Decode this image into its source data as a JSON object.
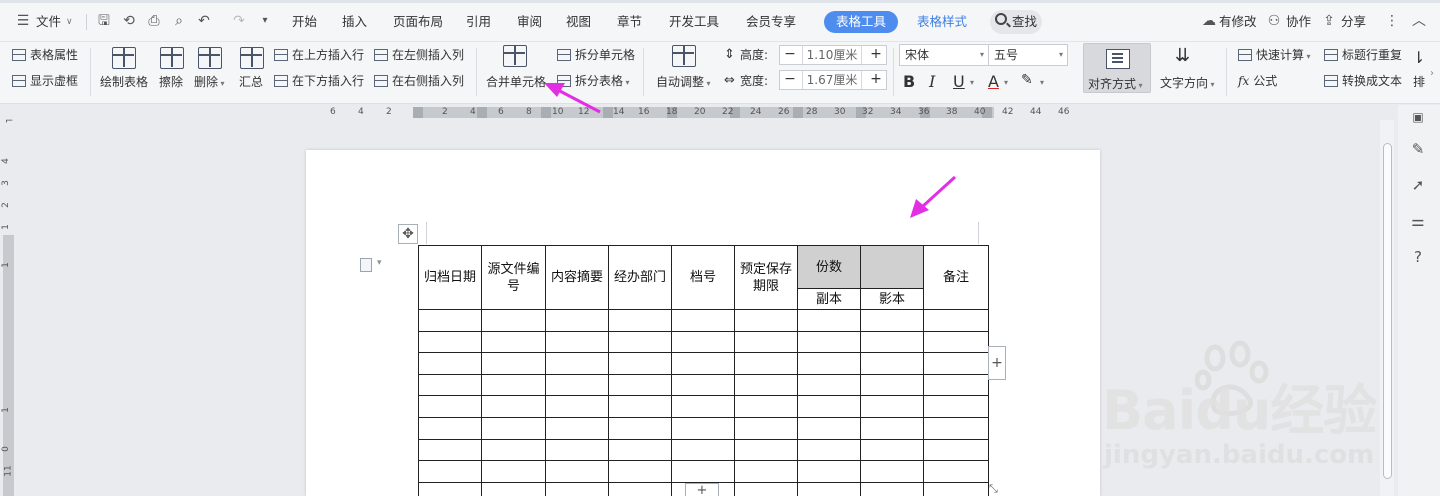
{
  "menubar": {
    "file": "文件",
    "tabs": [
      "开始",
      "插入",
      "页面布局",
      "引用",
      "审阅",
      "视图",
      "章节",
      "开发工具",
      "会员专享"
    ],
    "active_tab": "表格工具",
    "style_tab": "表格样式",
    "search": "查找",
    "right": {
      "changes": "有修改",
      "collab": "协作",
      "share": "分享"
    }
  },
  "ribbon": {
    "table_props": "表格属性",
    "show_grid": "显示虚框",
    "draw_table": "绘制表格",
    "erase": "擦除",
    "delete": "删除",
    "summary": "汇总",
    "insert_above": "在上方插入行",
    "insert_below": "在下方插入行",
    "insert_left": "在左侧插入列",
    "insert_right": "在右侧插入列",
    "merge_cells": "合并单元格",
    "split_cells": "拆分单元格",
    "split_table": "拆分表格",
    "auto_fit": "自动调整",
    "height_label": "高度:",
    "height_value": "1.10厘米",
    "width_label": "宽度:",
    "width_value": "1.67厘米",
    "font_name": "宋体",
    "font_size": "五号",
    "align": "对齐方式",
    "text_direction": "文字方向",
    "quick_calc": "快速计算",
    "formula": "公式",
    "repeat_header": "标题行重复",
    "convert_text": "转换成文本",
    "sort": "排"
  },
  "ruler": {
    "h_ticks": [
      "6",
      "4",
      "2",
      "2",
      "4",
      "6",
      "8",
      "10",
      "12",
      "14",
      "16",
      "18",
      "20",
      "22",
      "24",
      "26",
      "28",
      "30",
      "32",
      "34",
      "36",
      "38",
      "40",
      "42",
      "44",
      "46"
    ],
    "v_ticks": [
      "4",
      "3",
      "2",
      "1",
      "1",
      "1",
      "0",
      "11"
    ]
  },
  "table": {
    "header": [
      "归档日期",
      "源文件编号",
      "内容摘要",
      "经办部门",
      "档号",
      "预定保存期限",
      "份数",
      "",
      "备注"
    ],
    "subheader": [
      "副本",
      "影本"
    ],
    "body_rows": 9,
    "columns": 9,
    "highlight_color": "#d0d0d0"
  },
  "watermark": {
    "brand": "Baidu经验",
    "url": "jingyan.baidu.com"
  },
  "annotation_color": "#e22fe6"
}
